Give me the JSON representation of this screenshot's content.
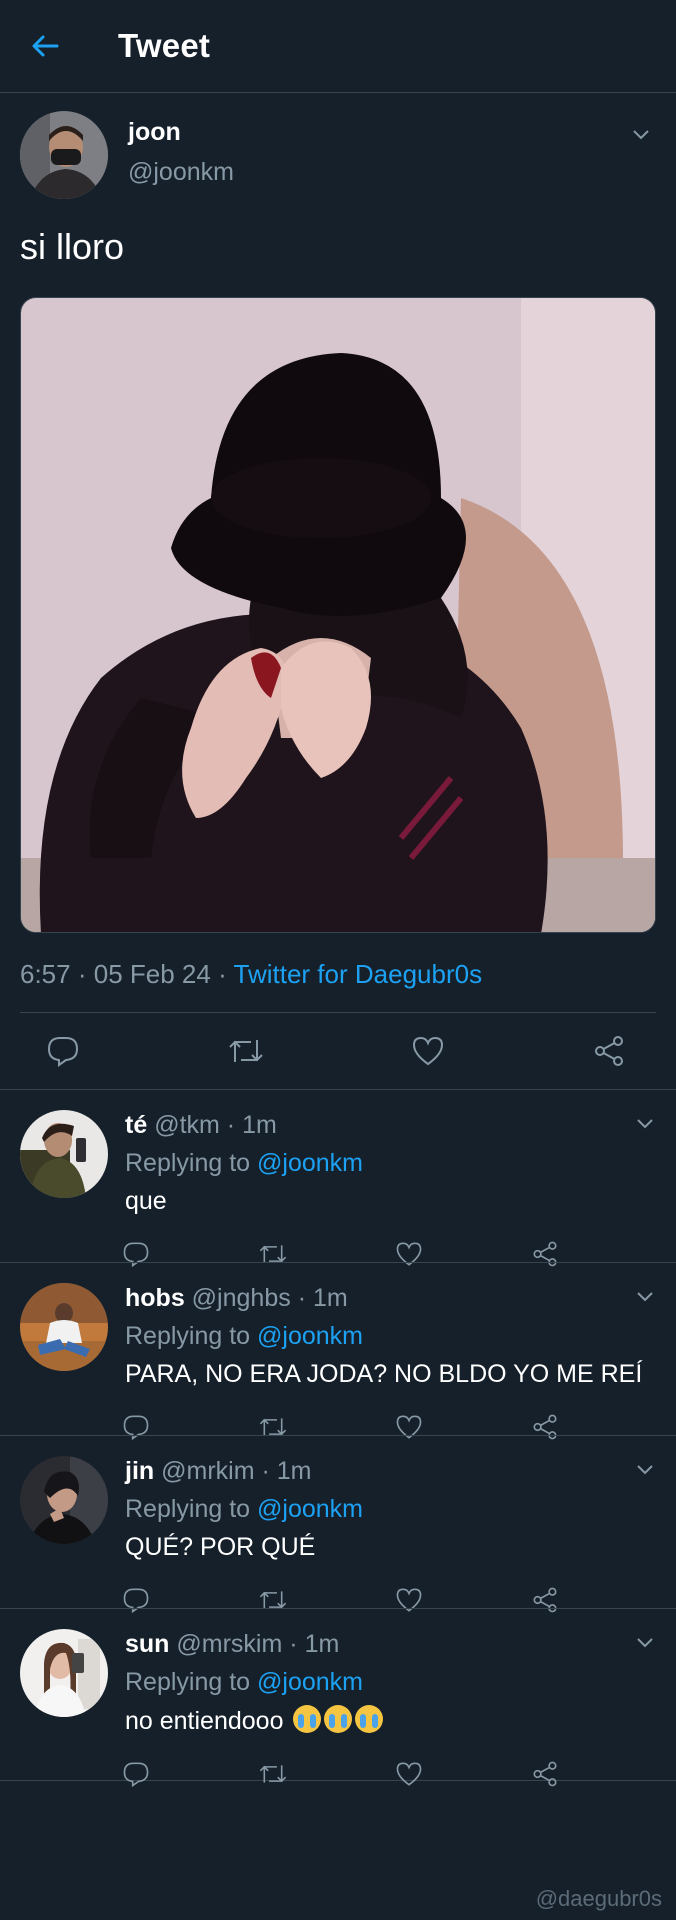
{
  "header": {
    "title": "Tweet"
  },
  "tweet": {
    "author_name": "joon",
    "author_handle": "@joonkm",
    "text": "si lloro",
    "time": "6:57",
    "date": "05 Feb 24",
    "source": "Twitter for Daegubr0s",
    "sep": "·"
  },
  "replies": [
    {
      "name": "té",
      "handle": "@tkm",
      "time": "1m",
      "replying_prefix": "Replying to",
      "replying_to": "@joonkm",
      "text": "que"
    },
    {
      "name": "hobs",
      "handle": "@jnghbs",
      "time": "1m",
      "replying_prefix": "Replying to",
      "replying_to": "@joonkm",
      "text": "PARA, NO ERA JODA? NO BLDO YO ME REÍ"
    },
    {
      "name": "jin",
      "handle": "@mrkim",
      "time": "1m",
      "replying_prefix": "Replying to",
      "replying_to": "@joonkm",
      "text": "QUÉ? POR QUÉ"
    },
    {
      "name": "sun",
      "handle": "@mrskim",
      "time": "1m",
      "replying_prefix": "Replying to",
      "replying_to": "@joonkm",
      "text": "no entiendooo"
    }
  ],
  "watermark": "@daegubr0s",
  "colors": {
    "background": "#15202b",
    "accent": "#1da1f2",
    "muted": "#8899a6",
    "divider": "#38444d"
  },
  "icons": [
    "back-arrow-icon",
    "chevron-down-icon",
    "reply-icon",
    "retweet-icon",
    "like-icon",
    "share-icon",
    "crying-face-emoji"
  ]
}
